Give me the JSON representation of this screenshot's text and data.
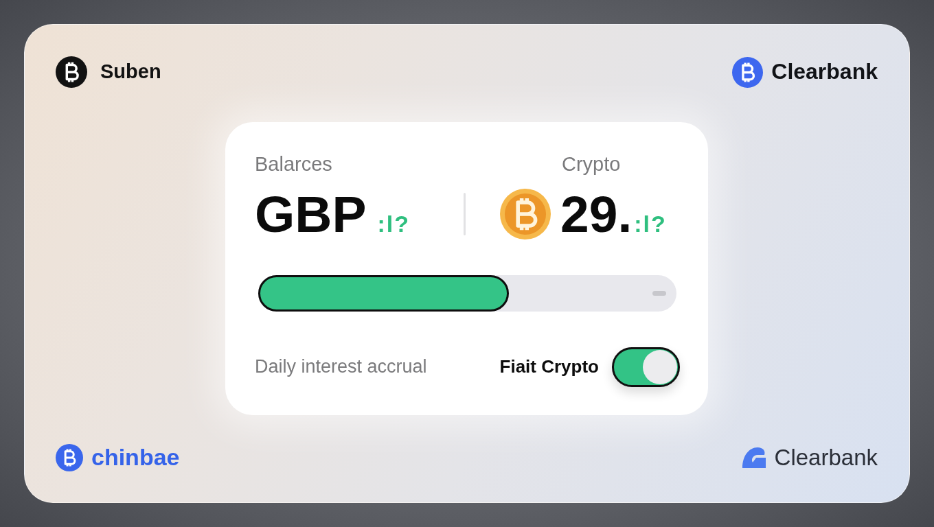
{
  "top_logos": [
    {
      "label": "Suben",
      "kind": "mono"
    },
    {
      "label": "Clearbank",
      "kind": "coin"
    }
  ],
  "card": {
    "fiat": {
      "heading": "Balarces",
      "currency": "GBP",
      "suffix": ":l?"
    },
    "crypto": {
      "heading": "Crypto",
      "amount": "29.",
      "suffix": ":l?"
    },
    "progress": {
      "level": 0.6
    },
    "caption": "Daily interest accrual",
    "toggle": {
      "label": "Fiait Crypto",
      "on": true
    }
  },
  "bottom_logos": [
    {
      "label": "chinbae",
      "kind": "tinted"
    },
    {
      "label": "Clearbank",
      "kind": "swoosh"
    }
  ]
}
